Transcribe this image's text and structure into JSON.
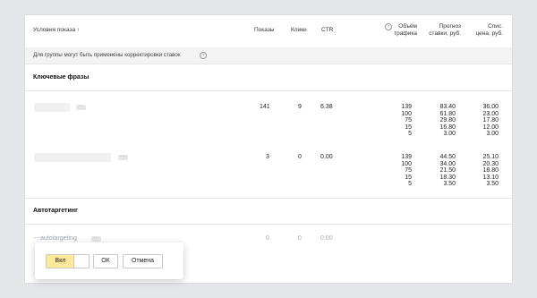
{
  "header": {
    "conditions": "Условия показа ↑",
    "shows": "Показы",
    "clicks": "Клики",
    "ctr": "CTR",
    "traffic_line1": "Объём",
    "traffic_line2": "трафика",
    "forecast_line1": "Прогноз",
    "forecast_line2": "ставки, руб.",
    "price_line1": "Спис.",
    "price_line2": "цена, руб."
  },
  "note": "Для группы могут быть применены корректировки ставок",
  "sections": {
    "keywords": "Ключевые фразы",
    "autotargeting": "Автотаргетинг"
  },
  "rows": [
    {
      "shows": "141",
      "clicks": "9",
      "ctr": "6.38",
      "traffic": [
        "139",
        "100",
        "75",
        "15",
        "5"
      ],
      "forecast": [
        "83.40",
        "61.80",
        "29.80",
        "16.80",
        "3.00"
      ],
      "price": [
        "36.00",
        "23.00",
        "17.80",
        "12.00",
        "3.00"
      ]
    },
    {
      "shows": "3",
      "clicks": "0",
      "ctr": "0.00",
      "traffic": [
        "139",
        "100",
        "75",
        "15",
        "5"
      ],
      "forecast": [
        "44.50",
        "34.00",
        "21.50",
        "18.30",
        "3.50"
      ],
      "price": [
        "25.10",
        "20.30",
        "18.80",
        "13.10",
        "3.50"
      ]
    }
  ],
  "autotargeting_row": {
    "label": "---autotargeting",
    "shows": "0",
    "clicks": "0",
    "ctr": "0.00"
  },
  "popup": {
    "toggle_label": "Вкл",
    "ok_label": "ОК",
    "cancel_label": "Отмена"
  },
  "more_glyph": "···",
  "help_glyph": "?"
}
